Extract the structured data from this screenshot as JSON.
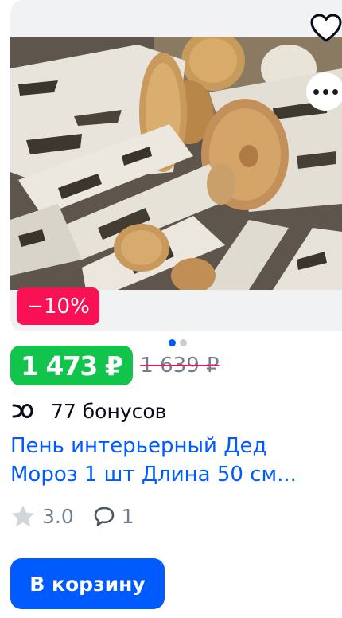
{
  "product": {
    "image_alt": "birch-logs-photo",
    "discount_badge": "−10%",
    "price_current": "1 473 ₽",
    "price_old": "1 639 ₽",
    "bonus_text": "77 бонусов",
    "title": "Пень интерьерный Дед Мороз 1 шт Длина 50 см...",
    "rating": "3.0",
    "reviews_count": "1",
    "carousel": {
      "total": 2,
      "active": 1
    }
  },
  "actions": {
    "add_to_cart_label": "В корзину"
  },
  "colors": {
    "accent": "#005bff",
    "discount": "#f91155",
    "price_bg": "#10c44c",
    "muted": "#707f8d"
  },
  "icons": [
    "heart-icon",
    "more-dots-icon",
    "bonus-icon",
    "star-icon",
    "comment-icon"
  ]
}
